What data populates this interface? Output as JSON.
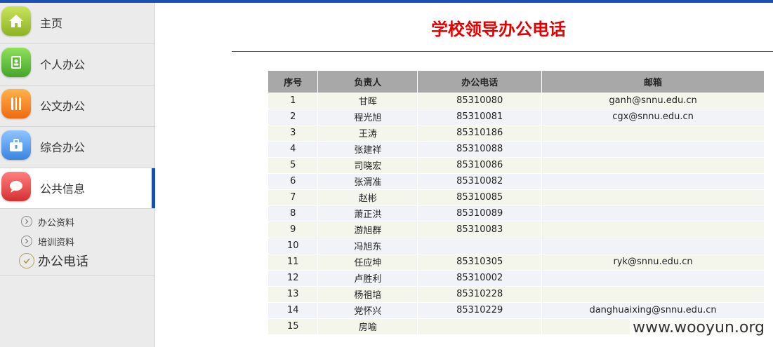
{
  "sidebar": {
    "items": [
      {
        "label": "主页",
        "icon": "home-icon"
      },
      {
        "label": "个人办公",
        "icon": "contacts-book-icon"
      },
      {
        "label": "公文办公",
        "icon": "document-icon"
      },
      {
        "label": "综合办公",
        "icon": "briefcase-icon"
      },
      {
        "label": "公共信息",
        "icon": "speech-bubble-icon",
        "active": true
      }
    ],
    "subitems": [
      {
        "label": "办公资料"
      },
      {
        "label": "培训资料"
      },
      {
        "label": "办公电话",
        "active": true
      }
    ]
  },
  "page": {
    "title": "学校领导办公电话"
  },
  "table": {
    "headers": [
      "序号",
      "负责人",
      "办公电话",
      "邮箱"
    ],
    "rows": [
      [
        "1",
        "甘晖",
        "85310080",
        "ganh@snnu.edu.cn"
      ],
      [
        "2",
        "程光旭",
        "85310081",
        "cgx@snnu.edu.cn"
      ],
      [
        "3",
        "王涛",
        "85310186",
        ""
      ],
      [
        "4",
        "张建祥",
        "85310088",
        ""
      ],
      [
        "5",
        "司晓宏",
        "85310086",
        ""
      ],
      [
        "6",
        "张渭准",
        "85310082",
        ""
      ],
      [
        "7",
        "赵彬",
        "85310085",
        ""
      ],
      [
        "8",
        "萧正洪",
        "85310089",
        ""
      ],
      [
        "9",
        "游旭群",
        "85310083",
        ""
      ],
      [
        "10",
        "冯旭东",
        "",
        ""
      ],
      [
        "11",
        "任应坤",
        "85310305",
        "ryk@snnu.edu.cn"
      ],
      [
        "12",
        "卢胜利",
        "85310002",
        ""
      ],
      [
        "13",
        "杨祖培",
        "85310228",
        ""
      ],
      [
        "14",
        "党怀兴",
        "85310229",
        "danghuaixing@snnu.edu.cn"
      ],
      [
        "15",
        "房喻",
        "",
        ""
      ]
    ]
  },
  "watermark": "www.wooyun.org",
  "colors": {
    "title_red": "#e60000",
    "top_bar_blue": "#1a4fb4",
    "active_marker_blue": "#1b4fad"
  }
}
